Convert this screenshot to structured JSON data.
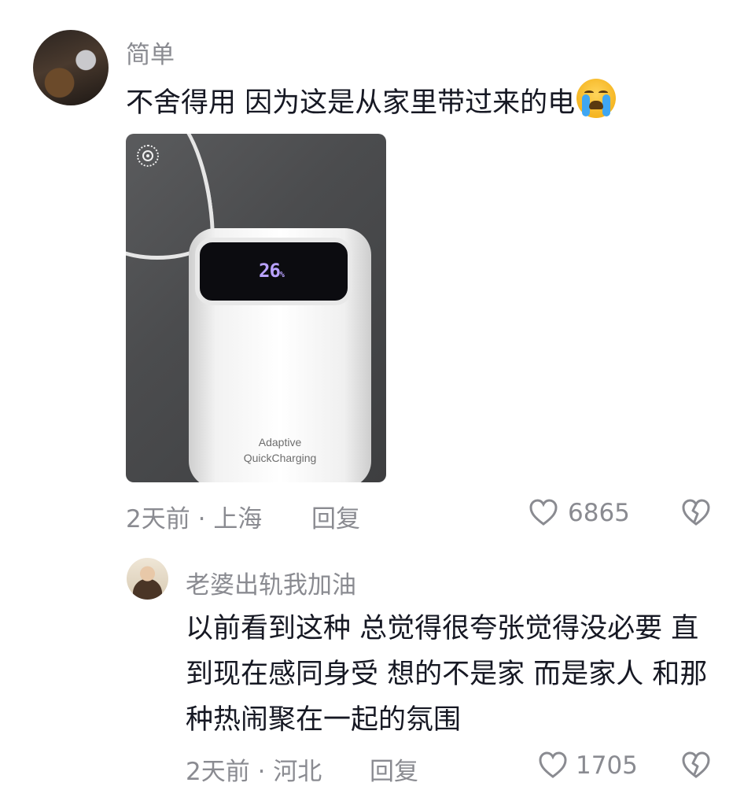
{
  "comment": {
    "username": "简单",
    "text": "不舍得用 因为这是从家里带过来的电",
    "emoji": "loudly-crying-face",
    "photo": {
      "battery_percent": "26",
      "percent_sign": "%",
      "brand_line1": "Adaptive",
      "brand_line2": "QuickCharging"
    },
    "time": "2天前",
    "location": "上海",
    "meta_separator": "·",
    "reply_label": "回复",
    "likes": "6865"
  },
  "reply": {
    "username": "老婆出轨我加油",
    "text": "以前看到这种 总觉得很夸张觉得没必要 直到现在感同身受 想的不是家 而是家人 和那种热闹聚在一起的氛围",
    "time": "2天前",
    "location": "河北",
    "meta_separator": "·",
    "reply_label": "回复",
    "likes": "1705"
  },
  "colors": {
    "text_primary": "#161823",
    "text_secondary": "#8a8b91",
    "battery_display": "#b9a2ff"
  }
}
